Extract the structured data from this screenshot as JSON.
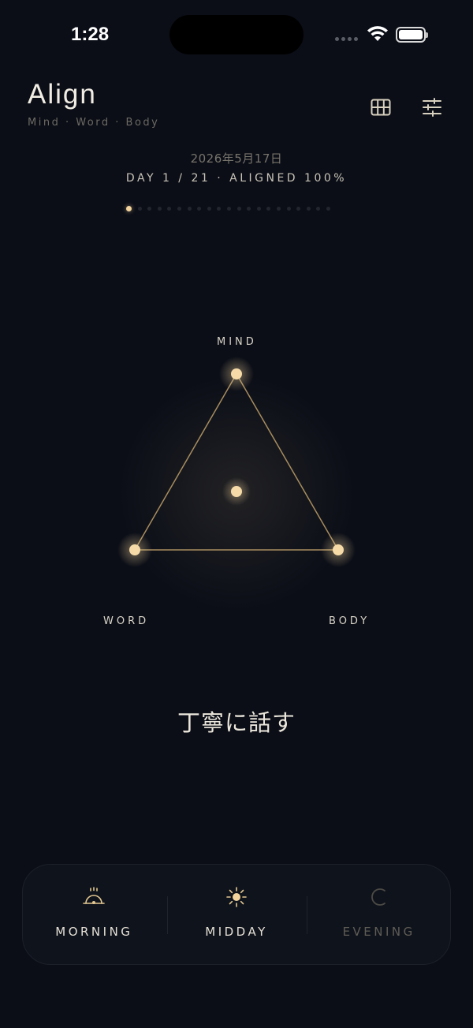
{
  "status_bar": {
    "time": "1:28",
    "icons": [
      "signal-dots-icon",
      "wifi-icon",
      "battery-icon"
    ]
  },
  "header": {
    "title": "Align",
    "subtitle": "Mind · Word · Body",
    "actions": [
      {
        "icon": "grid-icon"
      },
      {
        "icon": "sliders-icon"
      }
    ]
  },
  "progress": {
    "date": "2026年5月17日",
    "summary": "DAY 1 / 21  ·  ALIGNED 100%",
    "current_day": 1,
    "total_days": 21
  },
  "triangle": {
    "nodes": {
      "mind": "MIND",
      "word": "WORD",
      "body": "BODY"
    },
    "colors": {
      "node": "#f3d49c",
      "line": "#a88d5e"
    }
  },
  "intention": "丁寧に話す",
  "tabs": [
    {
      "label": "MORNING",
      "icon": "sunrise-icon",
      "active": true
    },
    {
      "label": "MIDDAY",
      "icon": "sun-icon",
      "active": true
    },
    {
      "label": "EVENING",
      "icon": "moon-icon",
      "active": false
    }
  ],
  "colors": {
    "background": "#0b0e17",
    "accent": "#f3d49c",
    "text": "#e9e4d8",
    "muted": "#6c6a63"
  }
}
